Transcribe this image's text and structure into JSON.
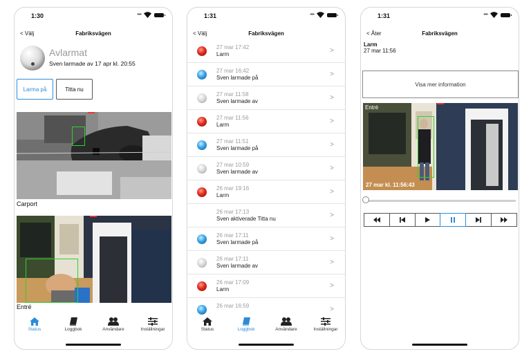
{
  "screens": [
    {
      "time": "1:30",
      "back": "< Välj",
      "title": "Fabriksvägen",
      "status_title": "Avlarmat",
      "status_sub": "Sven larmade av 17 apr kl. 20:55",
      "buttons": [
        "Larma på",
        "Titta nu"
      ],
      "cameras": [
        {
          "label": "Carport"
        },
        {
          "label": "Entré"
        }
      ]
    },
    {
      "time": "1:31",
      "back": "< Välj",
      "title": "Fabriksvägen",
      "events": [
        {
          "date": "27 mar 17:42",
          "text": "Larm",
          "icon": "red"
        },
        {
          "date": "27 mar 16:42",
          "text": "Sven larmade på",
          "icon": "blue"
        },
        {
          "date": "27 mar 11:58",
          "text": "Sven larmade av",
          "icon": "white"
        },
        {
          "date": "27 mar 11:56",
          "text": "Larm",
          "icon": "red"
        },
        {
          "date": "27 mar 11:51",
          "text": "Sven larmade på",
          "icon": "blue"
        },
        {
          "date": "27 mar 10:59",
          "text": "Sven larmade av",
          "icon": "white"
        },
        {
          "date": "26 mar 19:16",
          "text": "Larm",
          "icon": "red"
        },
        {
          "date": "26 mar 17:13",
          "text": "Sven aktiverade Titta nu",
          "icon": "none"
        },
        {
          "date": "26 mar 17:11",
          "text": "Sven larmade på",
          "icon": "blue"
        },
        {
          "date": "26 mar 17:11",
          "text": "Sven larmade av",
          "icon": "white"
        },
        {
          "date": "26 mar 17:09",
          "text": "Larm",
          "icon": "red"
        },
        {
          "date": "26 mar 16:59",
          "text": "",
          "icon": "blue"
        }
      ],
      "chevron": ">"
    },
    {
      "time": "1:31",
      "back": "< Åter",
      "title": "Fabriksvägen",
      "event_title": "Larm",
      "event_time": "27 mar 11:56",
      "info_button": "Visa mer information",
      "video_label": "Entré",
      "video_timestamp": "27 mar kl. 11:56:43",
      "playback_position": 0,
      "controls": [
        "fast-rewind",
        "skip-back",
        "play",
        "pause",
        "skip-forward",
        "fast-forward"
      ]
    }
  ],
  "tabs": [
    "Status",
    "Loggbok",
    "Användare",
    "Inställningar"
  ],
  "colors": {
    "accent": "#2e8bd8",
    "detect": "#2fd12f",
    "alarm": "#e02b1e"
  }
}
